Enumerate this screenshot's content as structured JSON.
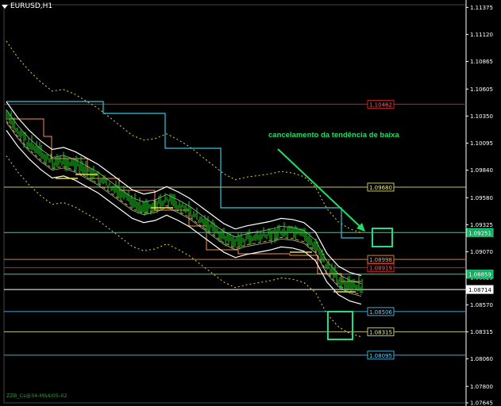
{
  "window": {
    "symbol_title": "EURUSD,H1"
  },
  "annotation": "cancelamento da tendência de baixa",
  "footer": "ZZB_Cs@34-MS4/05-02",
  "chart_data": {
    "type": "candlestick",
    "title": "EURUSD,H1",
    "ylim": [
      1.07645,
      1.114
    ],
    "axis_ticks": [
      "1.11375",
      "1.11120",
      "1.10865",
      "1.10605",
      "1.10350",
      "1.10095",
      "1.09840",
      "1.09580",
      "1.09325",
      "1.09070",
      "1.08825",
      "1.08570",
      "1.08315",
      "1.08060",
      "1.07800",
      "1.07645"
    ],
    "levels": [
      {
        "name": "level-red-1",
        "value": 1.10462,
        "label": "1.10462",
        "color": "#cc2222",
        "text": "#ff6060",
        "border": "#cc2222",
        "fill": "#000000"
      },
      {
        "name": "level-yellow-1",
        "value": 1.0968,
        "label": "1.09680",
        "color": "#c8c070",
        "text": "#f0f080",
        "border": "#c8c070",
        "fill": "#000000"
      },
      {
        "name": "level-green-current",
        "value": 1.09251,
        "label": "1.09251",
        "color": "#22dd88",
        "text": "#ffffff",
        "border": "#22dd88",
        "fill": "#1aa860"
      },
      {
        "name": "level-orange-1",
        "value": 1.08998,
        "label": "1.08998",
        "color": "#d08040",
        "text": "#f0a060",
        "border": "#d08040",
        "fill": "#000000"
      },
      {
        "name": "level-red-2",
        "value": 1.08919,
        "label": "1.08919",
        "color": "#cc2222",
        "text": "#ff6060",
        "border": "#cc2222",
        "fill": "#000000"
      },
      {
        "name": "level-green-2",
        "value": 1.08859,
        "label": "1.08859",
        "color": "#22dd88",
        "text": "#ffffff",
        "border": "#22dd88",
        "fill": "#1aa860"
      },
      {
        "name": "level-bid",
        "value": 1.08714,
        "label": "1.08714",
        "color": "#ffffff",
        "text": "#000000",
        "border": "#ffffff",
        "fill": "#ffffff"
      },
      {
        "name": "level-cyan-1",
        "value": 1.08506,
        "label": "1.08506",
        "color": "#44aacc",
        "text": "#60d0ff",
        "border": "#44aacc",
        "fill": "#000000"
      },
      {
        "name": "level-yellow-2",
        "value": 1.08315,
        "label": "1.08315",
        "color": "#c8c070",
        "text": "#f0f080",
        "border": "#c8c070",
        "fill": "#000000"
      },
      {
        "name": "level-cyan-2",
        "value": 1.08095,
        "label": "1.08095",
        "color": "#44aacc",
        "text": "#60d0ff",
        "border": "#44aacc",
        "fill": "#000000"
      }
    ],
    "price_line": [
      1.1035,
      1.102,
      1.1008,
      1.0998,
      1.099,
      1.0992,
      1.0988,
      1.0982,
      1.0976,
      1.0968,
      1.096,
      1.0952,
      1.0948,
      1.095,
      1.0955,
      1.095,
      1.0944,
      1.0936,
      1.0928,
      1.092,
      1.0915,
      1.0918,
      1.092,
      1.0922,
      1.0925,
      1.0924,
      1.0921,
      1.0912,
      1.0892,
      1.088,
      1.0874,
      1.0871
    ],
    "colors": {
      "candles": "#22cc22",
      "bands": "#ffffff",
      "dashed_channel": "#e8d040",
      "cyan_steps": "#30c8d8",
      "orange_steps": "#f09050",
      "arrow": "#22dd66",
      "grid_axis": "#ffffff"
    }
  }
}
